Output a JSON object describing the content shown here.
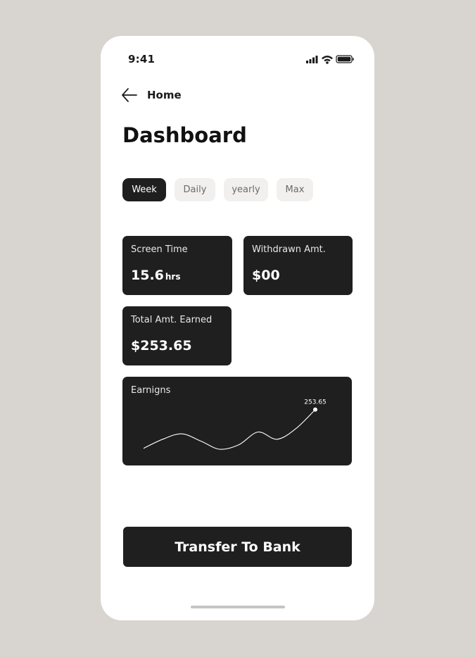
{
  "status_bar": {
    "time": "9:41",
    "icons": [
      "signal-icon",
      "wifi-icon",
      "battery-icon"
    ]
  },
  "nav": {
    "back_label": "Home",
    "back_icon": "arrow-left-icon"
  },
  "page": {
    "title": "Dashboard"
  },
  "tabs": [
    {
      "label": "Week",
      "active": true
    },
    {
      "label": "Daily",
      "active": false
    },
    {
      "label": "yearly",
      "active": false
    },
    {
      "label": "Max",
      "active": false
    }
  ],
  "cards": {
    "screen_time": {
      "label": "Screen Time",
      "value": "15.6",
      "unit": "hrs"
    },
    "withdrawn": {
      "label": "Withdrawn Amt.",
      "value": "$00"
    },
    "total_earned": {
      "label": "Total Amt. Earned",
      "value": "$253.65"
    }
  },
  "earnings_card": {
    "label": "Earnigns",
    "last_value_label": "253.65"
  },
  "chart_data": {
    "type": "line",
    "title": "Earnigns",
    "xlabel": "",
    "ylabel": "",
    "grid": false,
    "series": [
      {
        "values": [
          40,
          90,
          120,
          80,
          35,
          60,
          130,
          90,
          150,
          253.65
        ]
      }
    ],
    "annotations": [
      "253.65"
    ],
    "ylim": [
      0,
      260
    ]
  },
  "actions": {
    "transfer_label": "Transfer To Bank"
  },
  "colors": {
    "background": "#d8d4d0",
    "card": "#1f1f1f",
    "tab_inactive": "#f1f0ef",
    "text_primary": "#111111"
  }
}
